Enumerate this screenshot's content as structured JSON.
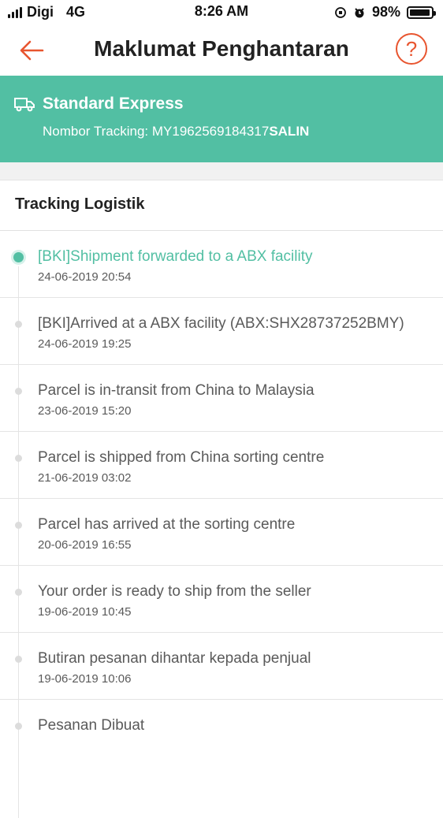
{
  "status_bar": {
    "carrier": "Digi",
    "network": "4G",
    "time": "8:26 AM",
    "battery": "98%",
    "battery_level": 0.98
  },
  "header": {
    "title": "Maklumat Penghantaran",
    "back_icon": "back-arrow-icon",
    "help_icon": "help-icon",
    "help_label": "?"
  },
  "shipping": {
    "method": "Standard Express",
    "tracking_label": "Nombor Tracking: ",
    "tracking_number": "MY1962569184317",
    "copy_label": "SALIN"
  },
  "tracking": {
    "title": "Tracking Logistik",
    "events": [
      {
        "text": "[BKI]Shipment forwarded to a ABX facility",
        "time": "24-06-2019 20:54"
      },
      {
        "text": "[BKI]Arrived at a ABX facility (ABX:SHX28737252BMY)",
        "time": "24-06-2019 19:25"
      },
      {
        "text": "Parcel is in-transit from China to Malaysia",
        "time": "23-06-2019 15:20"
      },
      {
        "text": "Parcel is shipped from China sorting centre",
        "time": "21-06-2019 03:02"
      },
      {
        "text": "Parcel has arrived at the sorting centre",
        "time": "20-06-2019 16:55"
      },
      {
        "text": "Your order is ready to ship from the seller",
        "time": "19-06-2019 10:45"
      },
      {
        "text": "Butiran pesanan dihantar kepada penjual",
        "time": "19-06-2019 10:06"
      },
      {
        "text": "Pesanan Dibuat",
        "time": ""
      }
    ]
  },
  "colors": {
    "accent": "#e8552f",
    "banner": "#52bfa3"
  }
}
